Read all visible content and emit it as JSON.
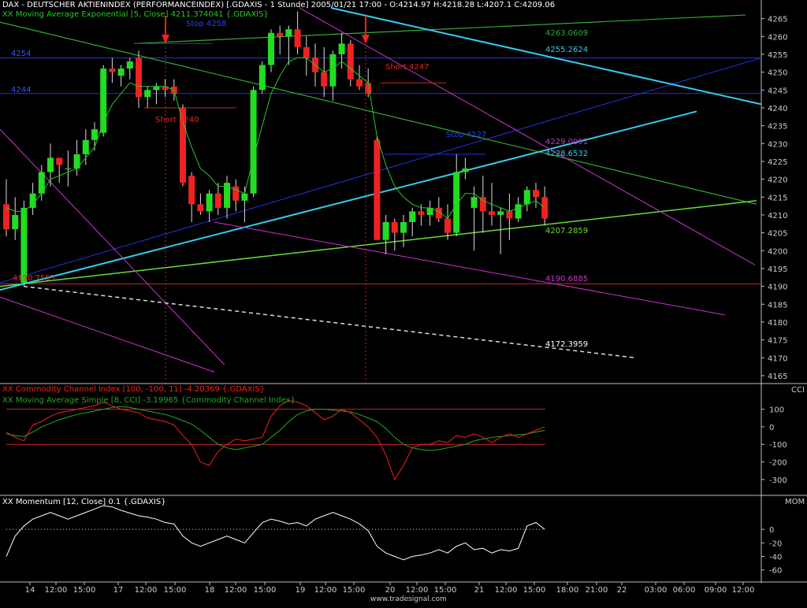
{
  "colors": {
    "background": "#000000",
    "panel_border": "#c0c0c0",
    "bull": "#22dd22",
    "bear": "#ee2222",
    "ema": "#22cc22",
    "cci": "#ee2222",
    "cci_ma": "#22aa22",
    "momentum": "#ffffff",
    "cyan": "#33ccee",
    "green_line": "#33aa33",
    "lime_line": "#66dd33",
    "magenta_line": "#cc33cc",
    "blue_line": "#2233dd",
    "red_line": "#cc2222",
    "axis_text": "#cccccc",
    "arrow": "#ee2222"
  },
  "header": {
    "price_title": "DAX  - DEUTSCHER AKTIENINDEX (PERFORMANCEINDEX) [.GDAXIS - 1 Stunde] 2005/01/21 17:00 - O:4214.97 H:4218.28 L:4207.1 C:4209.06",
    "ema_title": "XX Moving Average Exponential [5, Close] 4211.374041 {.GDAXIS}",
    "cci_title": "XX Commodity Channel Index [100, -100, 11] -4.20369 {.GDAXIS}",
    "cci_ma_title": "XX Moving Average Simple [8, CCI] -3.19965 {Commodity Channel Index}",
    "mom_title": "XX Momentum [12, Close] 0.1 {.GDAXIS}",
    "cci_axis_name": "CCI",
    "mom_axis_name": "MOM",
    "watermark": "www.tradesignal.com"
  },
  "annotations": {
    "stop_4258": "Stop 4258",
    "short_4240": "Short 4240",
    "short_4247": "Short 4247",
    "stop_4227": "Stop 4227",
    "level_4254": "4254",
    "level_4244": "4244",
    "level_4190": "4190.7553",
    "val_4263": "4263.0609",
    "val_4255": "4255.2624",
    "val_4229": "4229.0091",
    "val_4228": "4228.6532",
    "val_4207": "4207.2859",
    "val_4190": "4190.6885",
    "val_4172": "4172.3959"
  },
  "chart_data": [
    {
      "type": "candlestick",
      "series_name": "DAX",
      "ylim": [
        4163,
        4268
      ],
      "y_ticks": [
        "4165",
        "4170",
        "4175",
        "4180",
        "4185",
        "4190",
        "4195",
        "4200",
        "4205",
        "4210",
        "4215",
        "4220",
        "4225",
        "4230",
        "4235",
        "4240",
        "4245",
        "4250",
        "4255",
        "4260",
        "4265"
      ],
      "x_ticks": [
        "14",
        "12:00",
        "15:00",
        "17",
        "12:00",
        "15:00",
        "18",
        "12:00",
        "15:00",
        "19",
        "12:00",
        "15:00",
        "20",
        "12:00",
        "15:00",
        "21",
        "12:00",
        "15:00",
        "18:00",
        "21:00",
        "22",
        "03:00",
        "06:00",
        "09:00",
        "12:00"
      ],
      "ohlc": [
        [
          4213,
          4220,
          4204,
          4206
        ],
        [
          4206,
          4215,
          4203,
          4210
        ],
        [
          4191,
          4214,
          4190,
          4212
        ],
        [
          4212,
          4219,
          4210,
          4216
        ],
        [
          4216,
          4224,
          4214,
          4222
        ],
        [
          4222,
          4230,
          4218,
          4226
        ],
        [
          4226,
          4226,
          4219,
          4224
        ],
        [
          4223,
          4228,
          4218,
          4223
        ],
        [
          4223,
          4231,
          4221,
          4227
        ],
        [
          4227,
          4234,
          4224,
          4231
        ],
        [
          4231,
          4236,
          4228,
          4234
        ],
        [
          4233,
          4252,
          4232,
          4251
        ],
        [
          4251,
          4254,
          4247,
          4250
        ],
        [
          4249,
          4252,
          4246,
          4251
        ],
        [
          4251,
          4254,
          4248,
          4253
        ],
        [
          4254,
          4256,
          4240,
          4243
        ],
        [
          4243,
          4246,
          4240,
          4245
        ],
        [
          4245,
          4247,
          4241,
          4246
        ],
        [
          4246,
          4248,
          4243,
          4245
        ],
        [
          4246,
          4248,
          4242,
          4244
        ],
        [
          4240,
          4241,
          4218,
          4219
        ],
        [
          4221,
          4222,
          4208,
          4213
        ],
        [
          4213,
          4216,
          4210,
          4211
        ],
        [
          4211,
          4217,
          4208,
          4216
        ],
        [
          4216,
          4219,
          4210,
          4212
        ],
        [
          4212,
          4221,
          4209,
          4219
        ],
        [
          4218,
          4220,
          4211,
          4214
        ],
        [
          4214,
          4218,
          4208,
          4216
        ],
        [
          4216,
          4246,
          4215,
          4245
        ],
        [
          4245,
          4253,
          4244,
          4252
        ],
        [
          4252,
          4262,
          4250,
          4261
        ],
        [
          4261,
          4263,
          4255,
          4260
        ],
        [
          4260,
          4263,
          4252,
          4262
        ],
        [
          4262,
          4267,
          4255,
          4257
        ],
        [
          4257,
          4260,
          4249,
          4254
        ],
        [
          4254,
          4258,
          4246,
          4250
        ],
        [
          4250,
          4257,
          4243,
          4246
        ],
        [
          4246,
          4256,
          4242,
          4255
        ],
        [
          4255,
          4261,
          4251,
          4258
        ],
        [
          4258,
          4259,
          4246,
          4248
        ],
        [
          4248,
          4252,
          4245,
          4246
        ],
        [
          4247,
          4251,
          4243,
          4244
        ],
        [
          4231,
          4232,
          4203,
          4203
        ],
        [
          4203,
          4210,
          4199,
          4208
        ],
        [
          4208,
          4209,
          4200,
          4205
        ],
        [
          4205,
          4210,
          4201,
          4208
        ],
        [
          4208,
          4212,
          4204,
          4211
        ],
        [
          4211,
          4213,
          4207,
          4210
        ],
        [
          4210,
          4214,
          4207,
          4212
        ],
        [
          4212,
          4215,
          4208,
          4209
        ],
        [
          4209,
          4213,
          4203,
          4205
        ],
        [
          4205,
          4227,
          4204,
          4222
        ],
        [
          4222,
          4226,
          4220,
          4223
        ],
        [
          4212,
          4218,
          4200,
          4215
        ],
        [
          4215,
          4221,
          4205,
          4211
        ],
        [
          4211,
          4219,
          4207,
          4210
        ],
        [
          4210,
          4212,
          4199,
          4211
        ],
        [
          4211,
          4216,
          4203,
          4209
        ],
        [
          4209,
          4215,
          4208,
          4213
        ],
        [
          4213,
          4218,
          4211,
          4217
        ],
        [
          4217,
          4219,
          4212,
          4215
        ],
        [
          4215,
          4218,
          4207,
          4209
        ]
      ],
      "ema": [
        4212,
        4211,
        4211,
        4213,
        4216,
        4220,
        4221,
        4222,
        4223,
        4226,
        4229,
        4236,
        4241,
        4244,
        4247,
        4246,
        4246,
        4246,
        4246,
        4245,
        4236,
        4229,
        4223,
        4221,
        4218,
        4218,
        4217,
        4216,
        4226,
        4235,
        4244,
        4249,
        4253,
        4254,
        4254,
        4252,
        4250,
        4251,
        4253,
        4251,
        4249,
        4247,
        4232,
        4224,
        4218,
        4215,
        4213,
        4212,
        4212,
        4211,
        4209,
        4213,
        4216,
        4216,
        4214,
        4213,
        4212,
        4211,
        4212,
        4213,
        4214,
        4212
      ]
    },
    {
      "type": "line",
      "series_name": "Commodity Channel Index",
      "ylim": [
        -350,
        170
      ],
      "y_ticks": [
        "100",
        "0",
        "-100",
        "-200",
        "-300"
      ],
      "levels": [
        100,
        -100
      ],
      "cci": [
        -30,
        -60,
        -80,
        10,
        30,
        60,
        80,
        90,
        100,
        110,
        120,
        140,
        120,
        100,
        90,
        80,
        50,
        40,
        30,
        10,
        -50,
        -100,
        -200,
        -220,
        -140,
        -100,
        -70,
        -80,
        -70,
        -60,
        60,
        120,
        150,
        140,
        120,
        80,
        40,
        60,
        100,
        80,
        40,
        0,
        -60,
        -160,
        -300,
        -220,
        -120,
        -100,
        -100,
        -80,
        -90,
        -50,
        -60,
        -40,
        -60,
        -90,
        -60,
        -40,
        -60,
        -40,
        -20,
        0
      ],
      "cci_ma": [
        -40,
        -50,
        -55,
        -30,
        0,
        20,
        40,
        55,
        70,
        80,
        90,
        100,
        110,
        115,
        110,
        100,
        90,
        80,
        70,
        55,
        35,
        15,
        -20,
        -60,
        -100,
        -120,
        -130,
        -120,
        -110,
        -100,
        -60,
        -20,
        30,
        70,
        90,
        100,
        100,
        95,
        90,
        85,
        70,
        50,
        30,
        -10,
        -60,
        -100,
        -120,
        -130,
        -135,
        -130,
        -120,
        -110,
        -100,
        -80,
        -70,
        -60,
        -55,
        -50,
        -45,
        -40,
        -30,
        -20
      ]
    },
    {
      "type": "line",
      "series_name": "Momentum",
      "ylim": [
        -65,
        35
      ],
      "y_ticks": [
        "0",
        "-20",
        "-40",
        "-60"
      ],
      "momentum": [
        -40,
        -10,
        5,
        15,
        20,
        25,
        20,
        15,
        20,
        25,
        30,
        35,
        33,
        28,
        24,
        20,
        18,
        15,
        10,
        8,
        -10,
        -20,
        -25,
        -20,
        -15,
        -10,
        -15,
        -20,
        -5,
        10,
        15,
        12,
        8,
        10,
        5,
        15,
        20,
        25,
        20,
        15,
        8,
        -2,
        -25,
        -35,
        -40,
        -45,
        -40,
        -38,
        -35,
        -30,
        -35,
        -25,
        -20,
        -30,
        -28,
        -35,
        -30,
        -32,
        -28,
        5,
        10,
        0
      ]
    }
  ]
}
